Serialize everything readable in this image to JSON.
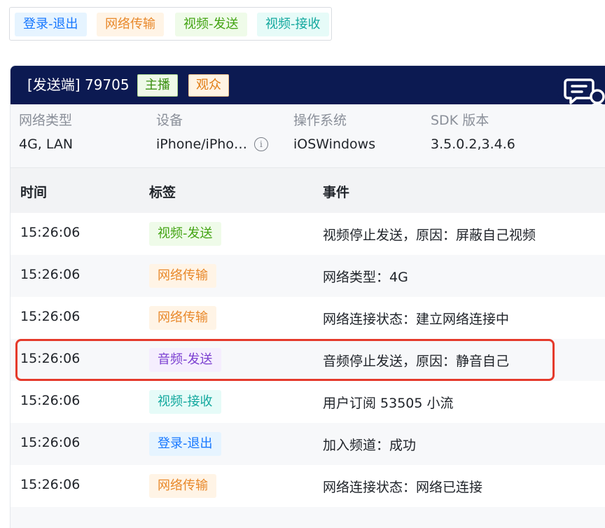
{
  "filters": [
    {
      "label": "登录-退出",
      "color": "blue"
    },
    {
      "label": "网络传输",
      "color": "orange"
    },
    {
      "label": "视频-发送",
      "color": "green"
    },
    {
      "label": "视频-接收",
      "color": "cyan"
    }
  ],
  "header": {
    "role": "[发送端]",
    "user_id": "79705",
    "host_tag": "主播",
    "audience_tag": "观众",
    "icon": "chat-user-icon"
  },
  "info": {
    "network": {
      "label": "网络类型",
      "value": "4G, LAN"
    },
    "device": {
      "label": "设备",
      "value": "iPhone/iPho…",
      "icon": "info-icon"
    },
    "os": {
      "label": "操作系统",
      "value": "iOSWindows"
    },
    "sdk": {
      "label": "SDK 版本",
      "value": "3.5.0.2,3.4.6"
    }
  },
  "table": {
    "headers": {
      "time": "时间",
      "tag": "标签",
      "event": "事件"
    },
    "rows": [
      {
        "time": "15:26:06",
        "tag": "视频-发送",
        "event": "视频停止发送，原因：屏蔽自己视频"
      },
      {
        "time": "15:26:06",
        "tag": "网络传输",
        "event": "网络类型：4G"
      },
      {
        "time": "15:26:06",
        "tag": "网络传输",
        "event": "网络连接状态：建立网络连接中"
      },
      {
        "time": "15:26:06",
        "tag": "音频-发送",
        "event": "音频停止发送，原因：静音自己"
      },
      {
        "time": "15:26:06",
        "tag": "视频-接收",
        "event": "用户订阅 53505 小流"
      },
      {
        "time": "15:26:06",
        "tag": "登录-退出",
        "event": "加入频道：成功"
      },
      {
        "time": "15:26:06",
        "tag": "网络传输",
        "event": "网络连接状态：网络已连接"
      }
    ]
  },
  "colors": {
    "header_bg": "#0c1a52",
    "highlight_border": "#e53a2b"
  }
}
